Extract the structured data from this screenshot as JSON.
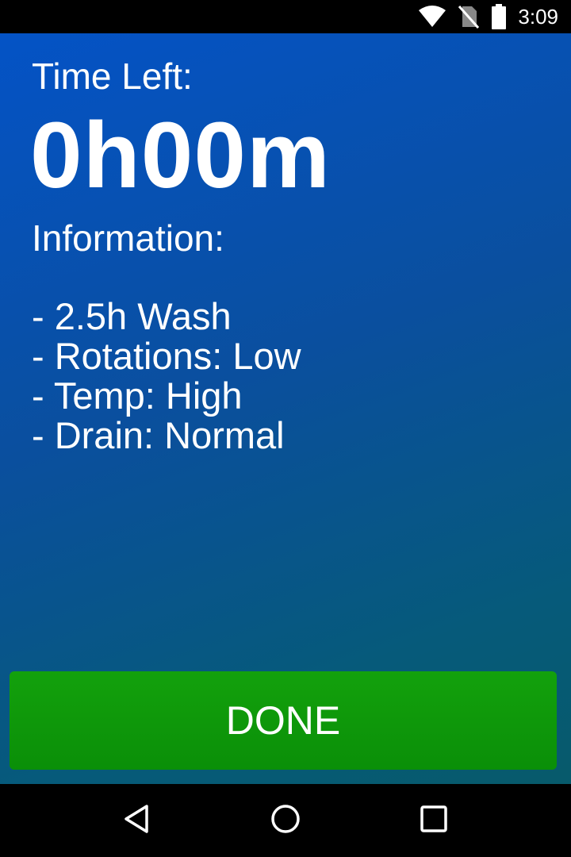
{
  "status_bar": {
    "time": "3:09",
    "icons": [
      "wifi-icon",
      "no-sim-icon",
      "battery-icon"
    ]
  },
  "main": {
    "time_left_label": "Time Left:",
    "time_left_value": "0h00m",
    "information_label": "Information:",
    "information_items": [
      "- 2.5h Wash",
      "- Rotations: Low",
      "- Temp: High",
      "- Drain: Normal"
    ],
    "done_label": "DONE"
  },
  "nav_bar": {
    "icons": [
      "back-icon",
      "home-icon",
      "recents-icon"
    ]
  },
  "colors": {
    "background_top": "#0453c6",
    "background_bottom": "#075a6b",
    "done_button": "#0e9a0a"
  }
}
